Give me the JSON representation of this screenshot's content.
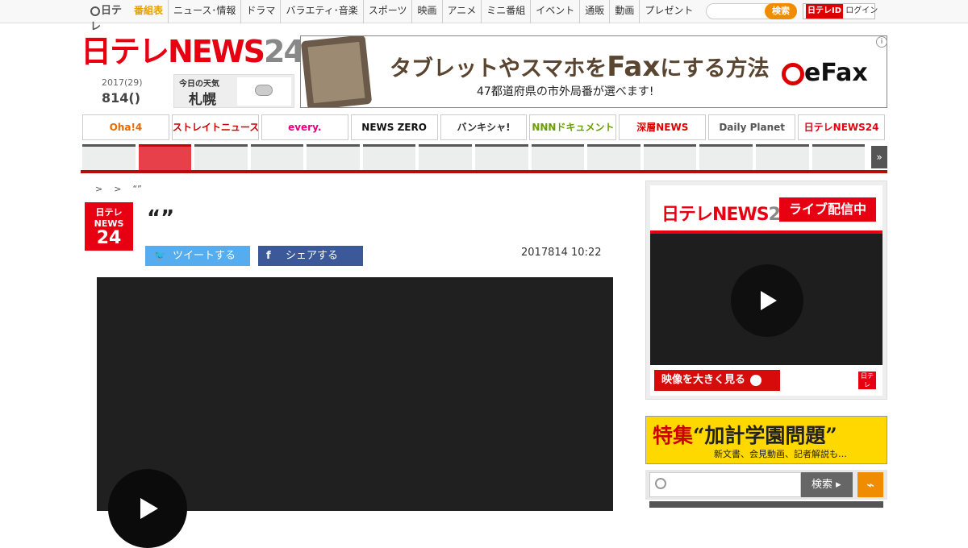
{
  "top_nav": {
    "logo": "日テレ",
    "items": [
      "番組表",
      "ニュース･情報",
      "ドラマ",
      "バラエティ･音楽",
      "スポーツ",
      "映画",
      "アニメ",
      "ミニ番組",
      "イベント",
      "通販",
      "動画",
      "プレゼント"
    ],
    "search_button": "検索",
    "login_brand": "日テレID",
    "login_label": "ログイン"
  },
  "site_logo": {
    "main": "日テレNEWS",
    "num": "24"
  },
  "date": {
    "line1": "2017(29)",
    "line2": "814()"
  },
  "weather": {
    "label": "今日の天気",
    "city": "札幌",
    "icon": "cloud-icon"
  },
  "ad": {
    "headline_pre": "タブレットやスマホを",
    "headline_fax": "Fax",
    "headline_post": "にする方法",
    "sub": "47都道府県の市外局番が選べます!",
    "brand": "eFax",
    "info": "i"
  },
  "shows": [
    {
      "label": "Oha!4",
      "color": "#e86a00"
    },
    {
      "label": "ストレイトニュース",
      "color": "#c00"
    },
    {
      "label": "every.",
      "color": "#e6007e"
    },
    {
      "label": "NEWS ZERO",
      "color": "#111"
    },
    {
      "label": "バンキシャ!",
      "color": "#333"
    },
    {
      "label": "NNNドキュメント",
      "color": "#6a9f00"
    },
    {
      "label": "深層NEWS",
      "color": "#d00"
    },
    {
      "label": "Daily Planet",
      "color": "#555"
    },
    {
      "label": "日テレNEWS24",
      "color": "#e60012"
    }
  ],
  "more": "»",
  "breadcrumb": [
    ">",
    ">",
    "“”"
  ],
  "news_logo": {
    "line1": "日テレ",
    "line2": "NEWS",
    "line3": "24"
  },
  "article": {
    "title": "“”",
    "tweet": "ツイートする",
    "share": "シェアする",
    "date": "2017814 10:22"
  },
  "live": {
    "logo_main": "日テレNEWS",
    "logo_num": "24",
    "badge": "ライブ配信中",
    "watch": "映像を大きく見る",
    "small": "日テレ"
  },
  "feature": {
    "title": "特集",
    "topic": "“加計学園問題”",
    "sub": "新文書、会見動画、記者解説も…"
  },
  "sidebar_search": {
    "button": "検索 ▸",
    "rss": "⌁"
  }
}
